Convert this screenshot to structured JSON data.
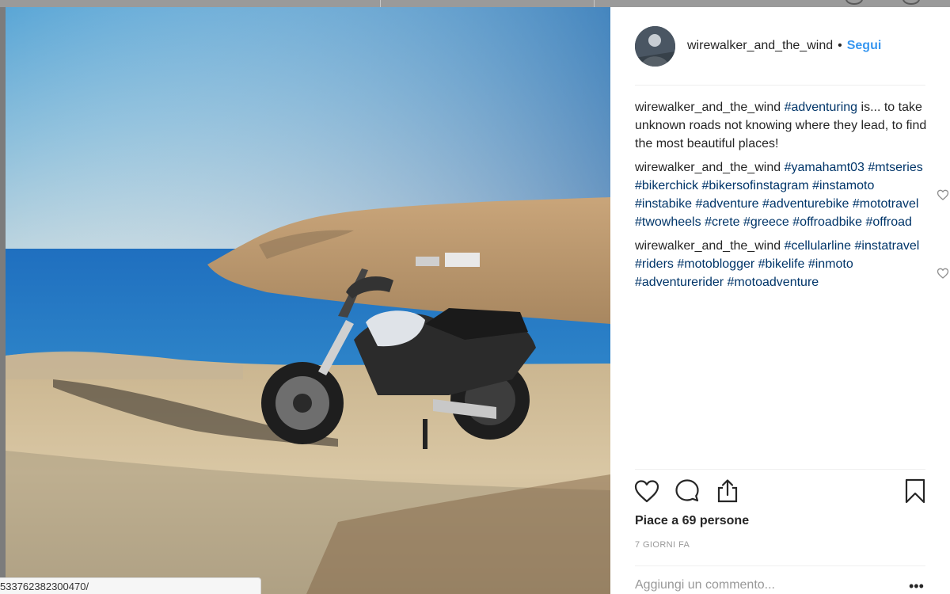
{
  "post": {
    "username": "wirewalker_and_the_wind",
    "separator": "•",
    "follow_label": "Segui",
    "comments": [
      {
        "author": "wirewalker_and_the_wind",
        "parts": [
          {
            "t": "tag",
            "v": "#adventuring"
          },
          {
            "t": "plain",
            "v": " is... to take unknown roads not knowing where they lead, to find the most beautiful places!"
          }
        ],
        "likeable": false
      },
      {
        "author": "wirewalker_and_the_wind",
        "parts": [
          {
            "t": "tag",
            "v": "#yamahamt03"
          },
          {
            "t": "plain",
            "v": " "
          },
          {
            "t": "tag",
            "v": "#mtseries"
          },
          {
            "t": "plain",
            "v": " "
          },
          {
            "t": "tag",
            "v": "#bikerchick"
          },
          {
            "t": "plain",
            "v": " "
          },
          {
            "t": "tag",
            "v": "#bikersofinstagram"
          },
          {
            "t": "plain",
            "v": " "
          },
          {
            "t": "tag",
            "v": "#instamoto"
          },
          {
            "t": "plain",
            "v": " "
          },
          {
            "t": "tag",
            "v": "#instabike"
          },
          {
            "t": "plain",
            "v": " "
          },
          {
            "t": "tag",
            "v": "#adventure"
          },
          {
            "t": "plain",
            "v": " "
          },
          {
            "t": "tag",
            "v": "#adventurebike"
          },
          {
            "t": "plain",
            "v": " "
          },
          {
            "t": "tag",
            "v": "#mototravel"
          },
          {
            "t": "plain",
            "v": " "
          },
          {
            "t": "tag",
            "v": "#twowheels"
          },
          {
            "t": "plain",
            "v": " "
          },
          {
            "t": "tag",
            "v": "#crete"
          },
          {
            "t": "plain",
            "v": " "
          },
          {
            "t": "tag",
            "v": "#greece"
          },
          {
            "t": "plain",
            "v": " "
          },
          {
            "t": "tag",
            "v": "#offroadbike"
          },
          {
            "t": "plain",
            "v": " "
          },
          {
            "t": "tag",
            "v": "#offroad"
          }
        ],
        "likeable": true
      },
      {
        "author": "wirewalker_and_the_wind",
        "parts": [
          {
            "t": "tag",
            "v": "#cellularline"
          },
          {
            "t": "plain",
            "v": " "
          },
          {
            "t": "tag",
            "v": "#instatravel"
          },
          {
            "t": "plain",
            "v": " "
          },
          {
            "t": "tag",
            "v": "#riders"
          },
          {
            "t": "plain",
            "v": " "
          },
          {
            "t": "tag",
            "v": "#motoblogger"
          },
          {
            "t": "plain",
            "v": " "
          },
          {
            "t": "tag",
            "v": "#bikelife"
          },
          {
            "t": "plain",
            "v": " "
          },
          {
            "t": "tag",
            "v": "#inmoto"
          },
          {
            "t": "plain",
            "v": " "
          },
          {
            "t": "tag",
            "v": "#adventurerider"
          },
          {
            "t": "plain",
            "v": " "
          },
          {
            "t": "tag",
            "v": "#motoadventure"
          }
        ],
        "likeable": true
      }
    ],
    "likes_text": "Piace a 69 persone",
    "time_ago": "7 GIORNI FA",
    "add_comment_placeholder": "Aggiungi un commento...",
    "more_options": "•••"
  },
  "status_bar": {
    "url_fragment": "5337623823004​70/"
  },
  "icons": {
    "like": "heart-icon",
    "comment": "comment-bubble-icon",
    "share": "share-icon",
    "save": "bookmark-icon",
    "comment_like": "heart-outline-icon"
  },
  "colors": {
    "link": "#003569",
    "follow": "#3897f0",
    "text": "#262626",
    "muted": "#999999"
  }
}
